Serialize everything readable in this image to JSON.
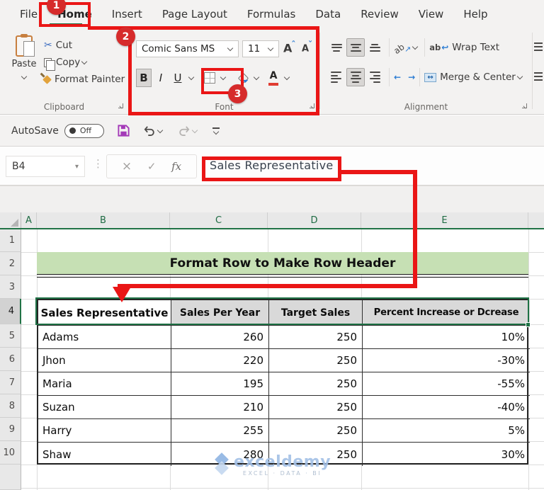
{
  "menubar": {
    "tabs": [
      "File",
      "Home",
      "Insert",
      "Page Layout",
      "Formulas",
      "Data",
      "Review",
      "View",
      "Help"
    ],
    "active_tab": "Home"
  },
  "ribbon": {
    "clipboard": {
      "label": "Clipboard",
      "paste": "Paste",
      "cut": "Cut",
      "copy": "Copy",
      "format_painter": "Format Painter"
    },
    "font": {
      "label": "Font",
      "font_name": "Comic Sans MS",
      "font_size": "11",
      "bold": "B",
      "italic": "I",
      "underline": "U",
      "grow_font": "A",
      "shrink_font": "A",
      "font_color_letter": "A"
    },
    "alignment": {
      "label": "Alignment",
      "wrap_text": "Wrap Text",
      "merge_center": "Merge & Center",
      "orientation_ab": "ab",
      "wrap_ab": "ab"
    }
  },
  "quick_access": {
    "autosave_label": "AutoSave",
    "autosave_state": "Off"
  },
  "formula_bar": {
    "name_box": "B4",
    "cancel": "×",
    "enter": "✓",
    "fx": "fx",
    "value": "Sales Representative"
  },
  "sheet": {
    "columns": [
      "A",
      "B",
      "C",
      "D",
      "E"
    ],
    "row_numbers": [
      "1",
      "2",
      "3",
      "4",
      "5",
      "6",
      "7",
      "8",
      "9",
      "10"
    ],
    "banner_title": "Format Row to Make Row Header",
    "table": {
      "headers": [
        "Sales Representative",
        "Sales Per Year",
        "Target Sales",
        "Percent Increase or Dcrease"
      ],
      "rows": [
        [
          "Adams",
          "260",
          "250",
          "10%"
        ],
        [
          "Jhon",
          "220",
          "250",
          "-30%"
        ],
        [
          "Maria",
          "195",
          "250",
          "-55%"
        ],
        [
          "Suzan",
          "210",
          "250",
          "-40%"
        ],
        [
          "Harry",
          "255",
          "250",
          "5%"
        ],
        [
          "Shaw",
          "280",
          "250",
          "30%"
        ]
      ]
    }
  },
  "annotations": {
    "step1": "1",
    "step2": "2",
    "step3": "3"
  },
  "watermark": {
    "brand": "exceldemy",
    "tagline": "EXCEL · DATA · BI"
  },
  "icons": {
    "scissors": "✂",
    "vdots": "⋮",
    "namebox_caret": "▾",
    "merge_arrows": "↔",
    "wrap_return": "↩",
    "orientation_arrow": "↗",
    "indent_left": "←",
    "indent_right": "→",
    "grow_caret": "ˆ",
    "shrink_caret": "ˇ"
  },
  "colors": {
    "excel_green": "#217346",
    "annotation_red": "#ea1616",
    "banner_green": "#c6e0b4",
    "header_fill": "#d9d9d9",
    "save_purple": "#a43ab8",
    "watermark_blue": "#a3c0e6"
  }
}
